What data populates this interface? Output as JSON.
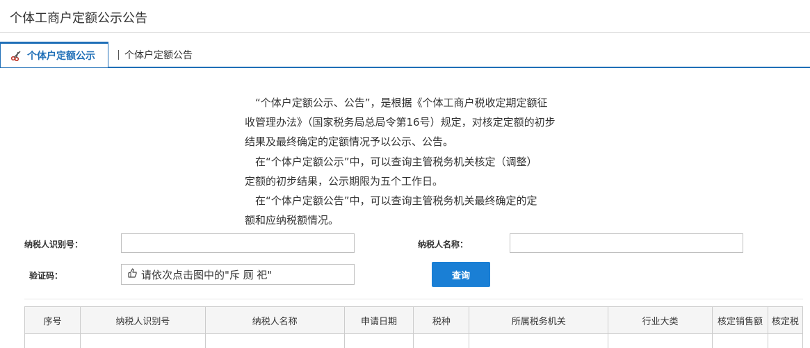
{
  "page": {
    "title": "个体工商户定额公示公告"
  },
  "tabs": [
    {
      "label": "个体户定额公示",
      "active": true,
      "icon": "scissors-icon"
    },
    {
      "label": "个体户定额公告",
      "active": false
    }
  ],
  "notice": {
    "lines": [
      "“个体户定额公示、公告”，是根据《个体工商户税收定期定额征",
      "收管理办法》（国家税务局总局令第16号）规定，对核定定额的初步",
      "结果及最终确定的定额情况予以公示、公告。",
      "在“个体户定额公示”中，可以查询主管税务机关核定（调整）",
      "定额的初步结果，公示期限为五个工作日。",
      "在“个体户定额公告”中，可以查询主管税务机关最终确定的定",
      "额和应纳税额情况。"
    ]
  },
  "form": {
    "taxpayer_id_label": "纳税人识别号：",
    "taxpayer_id_value": "",
    "taxpayer_name_label": "纳税人名称：",
    "taxpayer_name_value": "",
    "captcha_label": "验证码：",
    "captcha_prompt": "请依次点击图中的\"斥 厕 祀\"",
    "query_button": "查询"
  },
  "table": {
    "headers": [
      "序号",
      "纳税人识别号",
      "纳税人名称",
      "申请日期",
      "税种",
      "所属税务机关",
      "行业大类",
      "核定销售额",
      "核定税"
    ]
  },
  "colors": {
    "accent": "#1f6fb7",
    "button": "#1a7fd5"
  }
}
